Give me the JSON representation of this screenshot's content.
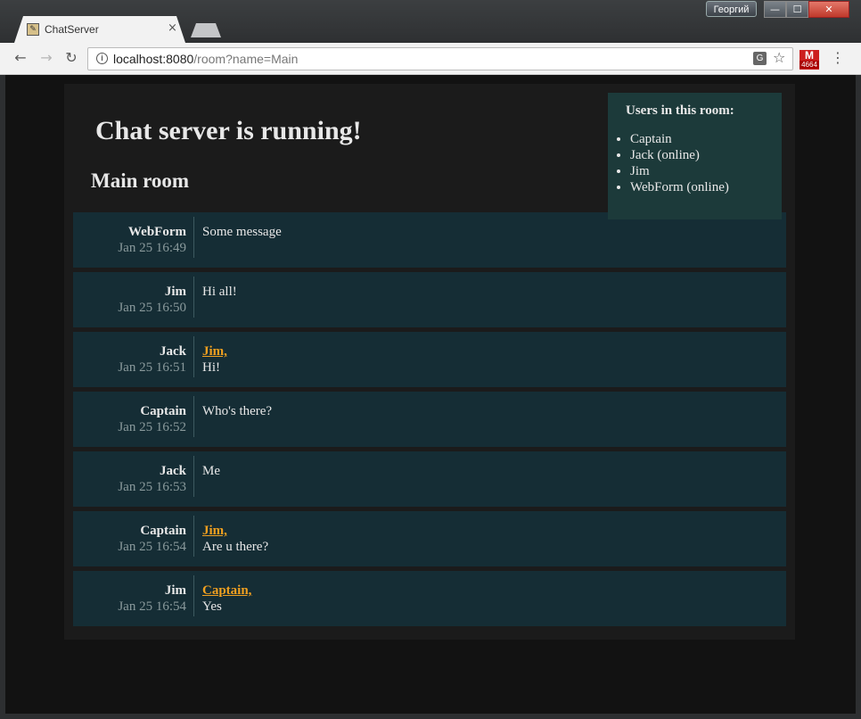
{
  "window": {
    "user": "Георгий",
    "minimize": "—",
    "maximize": "☐",
    "close": "✕"
  },
  "browser": {
    "tab_title": "ChatServer",
    "tab_close": "×",
    "url_host": "localhost:8080",
    "url_path": "/room?name=Main",
    "ext_label": "M",
    "ext_count": "4664"
  },
  "page": {
    "title": "Chat server is running!",
    "room_title": "Main room"
  },
  "users": {
    "heading": "Users in this room:",
    "list": [
      "Captain",
      "Jack (online)",
      "Jim",
      "WebForm (online)"
    ]
  },
  "messages": [
    {
      "author": "WebForm",
      "time": "Jan 25 16:49",
      "mention": "",
      "text": "Some message"
    },
    {
      "author": "Jim",
      "time": "Jan 25 16:50",
      "mention": "",
      "text": "Hi all!"
    },
    {
      "author": "Jack",
      "time": "Jan 25 16:51",
      "mention": "Jim,",
      "text": "Hi!"
    },
    {
      "author": "Captain",
      "time": "Jan 25 16:52",
      "mention": "",
      "text": "Who's there?"
    },
    {
      "author": "Jack",
      "time": "Jan 25 16:53",
      "mention": "",
      "text": "Me"
    },
    {
      "author": "Captain",
      "time": "Jan 25 16:54",
      "mention": "Jim,",
      "text": "Are u there?"
    },
    {
      "author": "Jim",
      "time": "Jan 25 16:54",
      "mention": "Captain,",
      "text": "Yes"
    }
  ],
  "colors": {
    "mention": "#f0a020",
    "message_bg": "#152d35",
    "users_panel_bg": "#1c3a3a",
    "page_bg": "#121212"
  }
}
